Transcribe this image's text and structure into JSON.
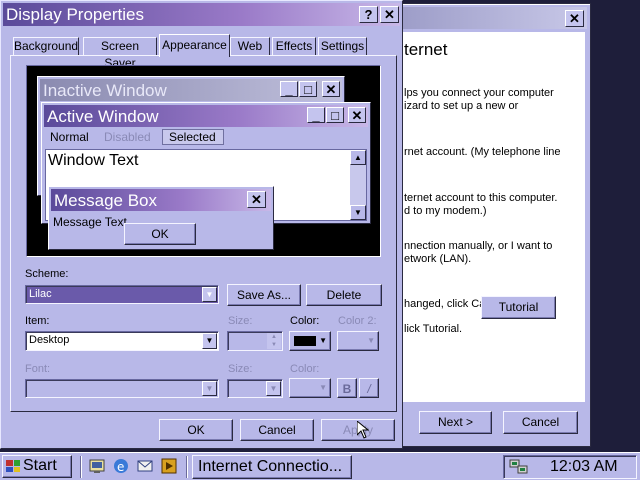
{
  "back_window": {
    "heading": "ternet",
    "lines": [
      "lps you connect your computer",
      "izard to set up a new or",
      "rnet account. (My telephone line",
      "ternet account to this computer.",
      "d to my modem.)",
      "nnection manually, or I want to",
      "etwork (LAN).",
      "hanged, click Cancel.",
      "lick Tutorial."
    ],
    "tutorial": "Tutorial",
    "next": "Next >",
    "cancel": "Cancel",
    "close": "✕"
  },
  "dialog": {
    "title": "Display Properties",
    "help": "?",
    "close": "✕",
    "tabs": [
      "Background",
      "Screen Saver",
      "Appearance",
      "Web",
      "Effects",
      "Settings"
    ],
    "preview": {
      "inactive": "Inactive Window",
      "active": "Active Window",
      "menu": [
        "Normal",
        "Disabled",
        "Selected"
      ],
      "window_text": "Window Text",
      "msgbox_title": "Message Box",
      "msgbox_text": "Message Text",
      "ok": "OK",
      "min": "_",
      "max": "□",
      "x": "✕"
    },
    "scheme_label": "Scheme:",
    "scheme_value": "Lilac",
    "save_as": "Save As...",
    "delete": "Delete",
    "item_label": "Item:",
    "item_value": "Desktop",
    "size_label": "Size:",
    "color_label": "Color:",
    "color2_label": "Color 2:",
    "font_label": "Font:",
    "font_size_label": "Size:",
    "font_color_label": "Color:",
    "bold": "B",
    "italic": "/",
    "ok": "OK",
    "cancel": "Cancel",
    "apply": "Apply"
  },
  "taskbar": {
    "start": "Start",
    "task_button": "Internet Connectio...",
    "clock": "12:03 AM"
  },
  "colors": {
    "accent": "#5a4a9a",
    "face": "#b8b8e8",
    "scheme_highlight": "#6a5aaa"
  }
}
